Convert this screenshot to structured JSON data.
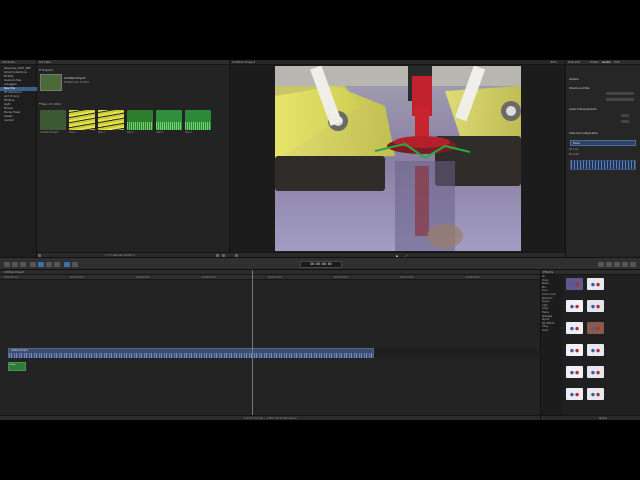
{
  "library": {
    "header": "Libraries",
    "items": [
      {
        "label": "Pequenas_2007_PEP",
        "selected": false
      },
      {
        "label": "Smart Collections",
        "selected": false
      },
      {
        "label": "Bt Mirg",
        "selected": false
      },
      {
        "label": "husband-files",
        "selected": false
      },
      {
        "label": "untagged",
        "selected": false
      },
      {
        "label": "New Pile",
        "selected": true
      },
      {
        "label": "HF Aluminum",
        "selected": false
      },
      {
        "label": "port # long",
        "selected": false
      },
      {
        "label": "HE Nine",
        "selected": false
      },
      {
        "label": "Light",
        "selected": false
      },
      {
        "label": "Booper",
        "selected": false
      },
      {
        "label": "Binder Head",
        "selected": false
      },
      {
        "label": "Assets",
        "selected": false
      },
      {
        "label": "random",
        "selected": false
      }
    ]
  },
  "browser": {
    "header": "All Clips",
    "projects_label": "Projects",
    "project_name": "Untitled Project",
    "project_meta": "Modified: Nov 13 2014",
    "date_group": "Nov 13, 2014",
    "clips": [
      {
        "label": "Untitled Project",
        "color": "#3b5a33"
      },
      {
        "label": "Clip 2",
        "color": "#b8c230"
      },
      {
        "label": "Clip 3",
        "color": "#c4c43a"
      },
      {
        "label": "Clip 4",
        "color": "#2e7d2e"
      },
      {
        "label": "Clip 5",
        "color": "#2f8f3c"
      },
      {
        "label": "Clip 6",
        "color": "#2a8a3a"
      }
    ],
    "footer": "1 of 7 selected, 00:00:11"
  },
  "viewer": {
    "header": "Untitled Project",
    "zoom": "50%"
  },
  "toolbar": {
    "timecode": "00:00:00:00"
  },
  "timeline": {
    "header": "Untitled Project",
    "ruler_ticks": [
      "00:00:00:00",
      "00:00:05:00",
      "00:00:10:00",
      "00:00:15:00",
      "00:00:20:00",
      "00:00:25:00",
      "00:00:30:00",
      "00:00:35:00"
    ],
    "storyline_label": "Untitled Project",
    "audio_label": "Audio",
    "footer": "0:00:21:19 total — 1080p HD 23.98p Stereo"
  },
  "inspector": {
    "header": "Clip Info",
    "tabs": [
      "Video",
      "Audio",
      "Info"
    ],
    "sections": {
      "volume": "Volume",
      "volume_and_pan": "Volume and Pan",
      "audio_enhancements": "Audio Enhancements",
      "channel_config": "Channel Configuration",
      "stereo_label": "Stereo",
      "track1": "Ch 1 (L)",
      "track2": "Ch 2 (R)"
    },
    "footer": ""
  },
  "effects": {
    "header": "Effects",
    "footer": "Stylize",
    "categories": [
      "All",
      "Video",
      "Basics",
      "Blur",
      "Color",
      "Comic Looks",
      "Distortion",
      "Keying",
      "Light",
      "Looks",
      "Masks",
      "Nostalgia",
      "Stylize",
      "Text Effects",
      "Tiling",
      "Audio"
    ]
  }
}
